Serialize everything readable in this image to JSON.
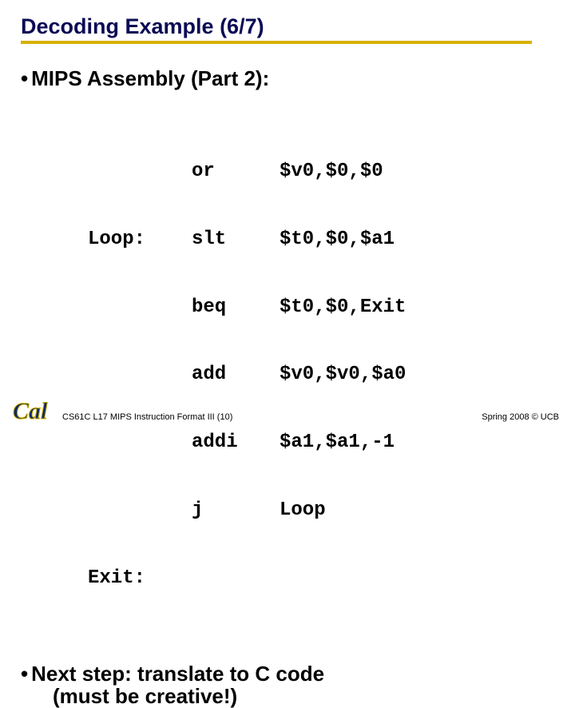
{
  "title": "Decoding Example (6/7)",
  "bullet1": "MIPS Assembly (Part 2):",
  "code": {
    "rows": [
      {
        "label": "",
        "instr": "or",
        "args": "$v0,$0,$0"
      },
      {
        "label": "Loop:",
        "instr": "slt",
        "args": "$t0,$0,$a1"
      },
      {
        "label": "",
        "instr": "beq",
        "args": "$t0,$0,Exit"
      },
      {
        "label": "",
        "instr": "add",
        "args": "$v0,$v0,$a0"
      },
      {
        "label": "",
        "instr": "addi",
        "args": "$a1,$a1,-1"
      },
      {
        "label": "",
        "instr": "j",
        "args": "Loop"
      },
      {
        "label": "Exit:",
        "instr": "",
        "args": ""
      }
    ]
  },
  "bullet2_line1": "Next step: translate to C code",
  "bullet2_line2": "(must be creative!)",
  "footer_left": "CS61C L17 MIPS Instruction Format III (10)",
  "footer_right": "Spring 2008 © UCB",
  "logo_text": "Cal"
}
